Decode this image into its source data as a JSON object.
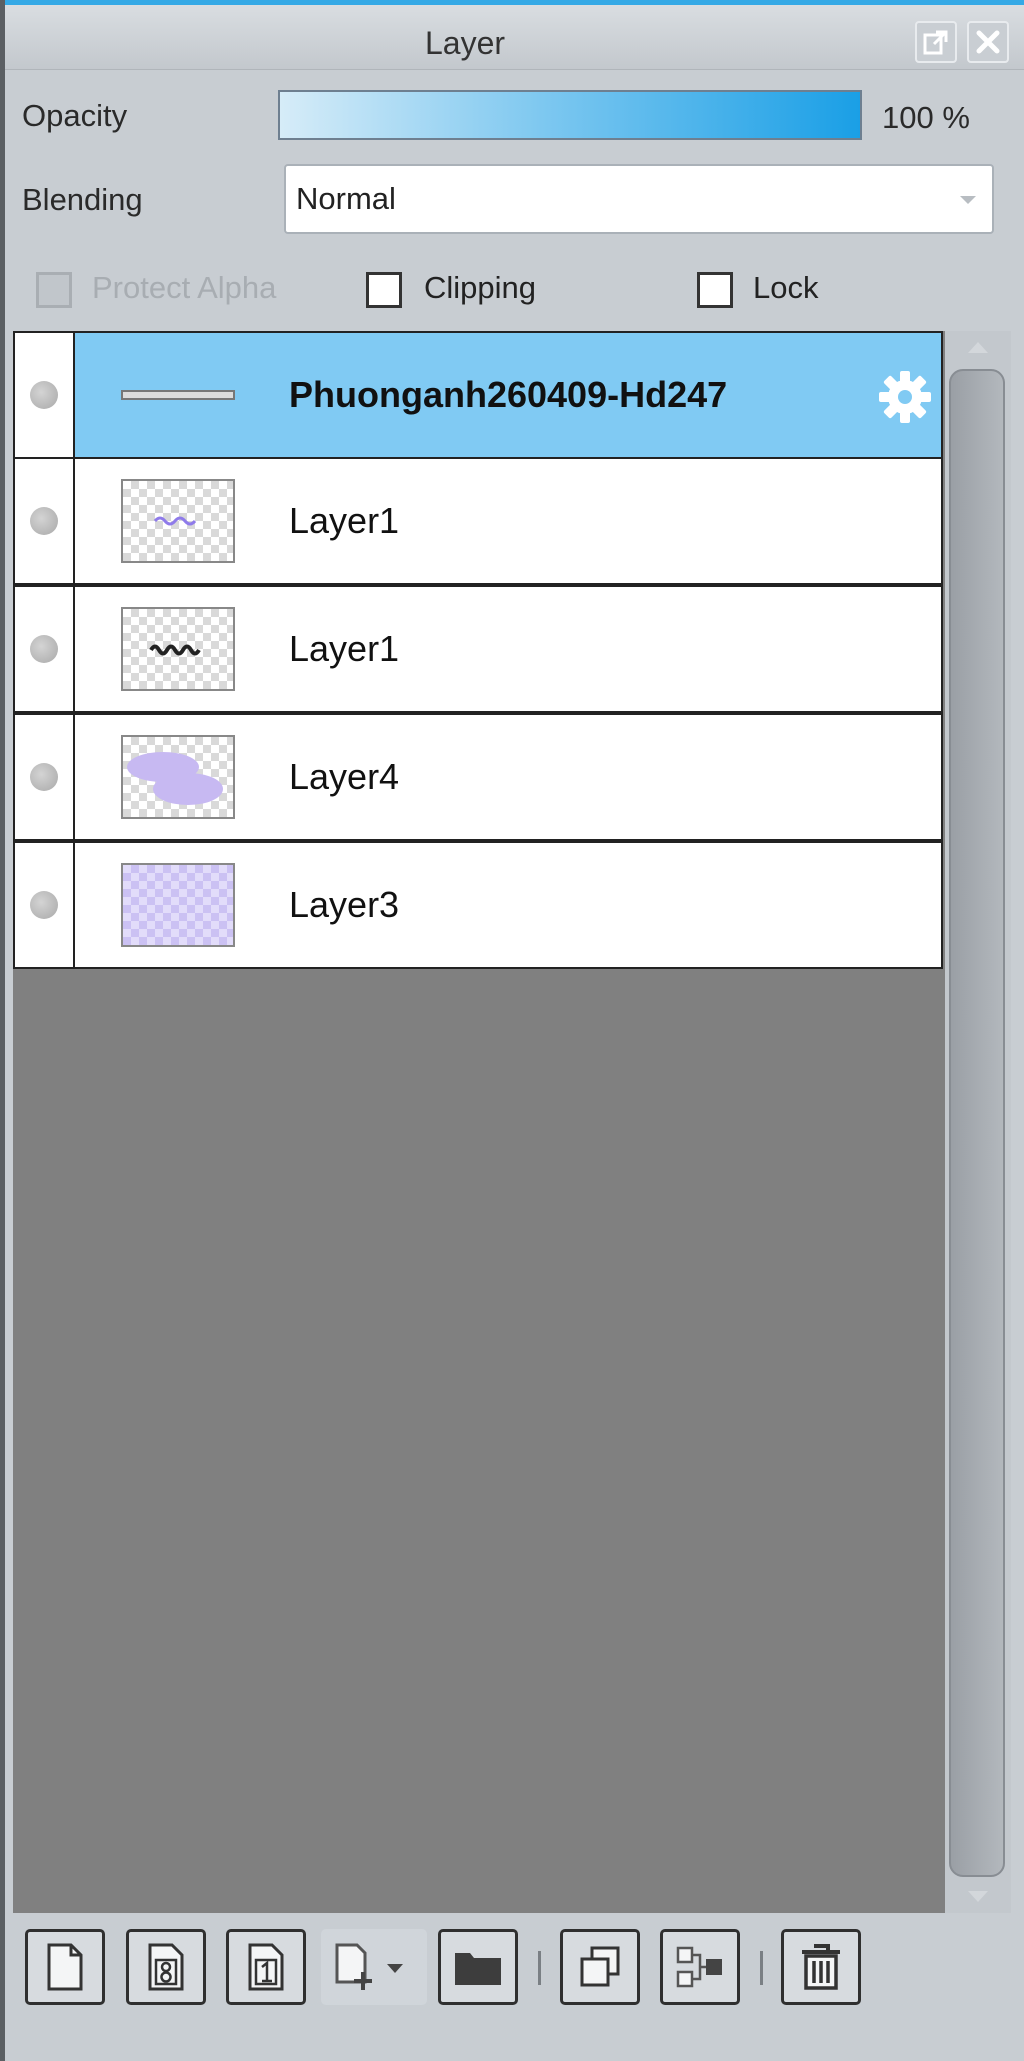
{
  "panel": {
    "title": "Layer"
  },
  "titlebar": {
    "popout_icon": "popout-icon",
    "close_icon": "close-icon"
  },
  "opacity": {
    "label": "Opacity",
    "value_text": "100 %",
    "value": 1.0
  },
  "blending": {
    "label": "Blending",
    "value": "Normal"
  },
  "options": {
    "protect_alpha": {
      "label": "Protect Alpha",
      "checked": false,
      "disabled": true
    },
    "clipping": {
      "label": "Clipping",
      "checked": false
    },
    "lock": {
      "label": "Lock",
      "checked": false
    }
  },
  "layers": [
    {
      "name": "Phuonganh260409-Hd247",
      "selected": true,
      "type": "folder",
      "icon": "gear-icon"
    },
    {
      "name": "Layer1",
      "selected": false,
      "thumb": "purple-text"
    },
    {
      "name": "Layer1",
      "selected": false,
      "thumb": "dark-text"
    },
    {
      "name": "Layer4",
      "selected": false,
      "thumb": "purple-blobs"
    },
    {
      "name": "Layer3",
      "selected": false,
      "thumb": "purple-fill"
    }
  ],
  "toolbar": {
    "buttons": [
      "new-layer-icon",
      "new-8bit-layer-icon",
      "new-1bit-layer-icon",
      "add-layer-dropdown-icon",
      "new-folder-icon",
      "duplicate-layer-icon",
      "merge-down-icon",
      "delete-layer-icon"
    ]
  },
  "colors": {
    "accent": "#1a9fe6",
    "selected_row": "#80caf3",
    "list_background": "#808080",
    "panel_background": "#c8cdd2"
  }
}
